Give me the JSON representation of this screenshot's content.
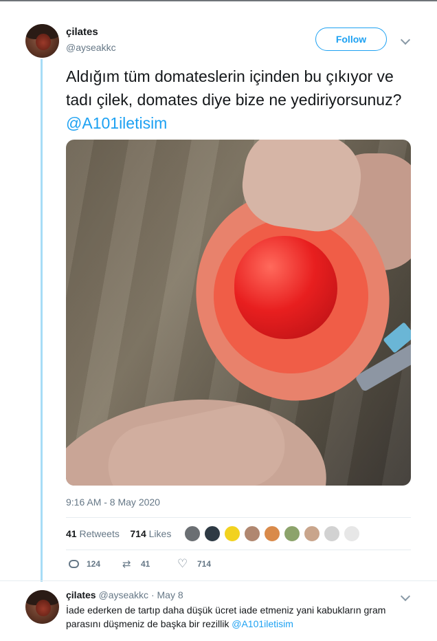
{
  "tweet": {
    "display_name": "çilates",
    "handle": "@ayseakkc",
    "follow_label": "Follow",
    "text": "Aldığım tüm domateslerin içinden bu çıkıyor ve tadı çilek, domates diye bize ne yediriyorsunuz?",
    "mention": "@A101iletisim",
    "timestamp": "9:16 AM - 8 May 2020",
    "retweets_count": "41",
    "retweets_label": "Retweets",
    "likes_count": "714",
    "likes_label": "Likes",
    "likers": [
      "#6b6f73",
      "#2e3a44",
      "#f2d21f",
      "#b08770",
      "#d98a4a",
      "#8ca36b",
      "#c9a58c",
      "#d2d2d2",
      "#e7e7e7"
    ],
    "actions": {
      "reply_count": "124",
      "retweet_count": "41",
      "like_count": "714"
    }
  },
  "reply": {
    "display_name": "çilates",
    "handle": "@ayseakkc",
    "separator": "·",
    "date": "May 8",
    "text": "İade ederken de tartıp daha düşük ücret iade etmeniz yani kabukların gram parasını düşmeniz de başka bir rezillik",
    "mention": "@A101iletisim"
  },
  "colors": {
    "accent": "#1da1f2",
    "thread_line": "#a7dcf6",
    "secondary_text": "#657786"
  }
}
